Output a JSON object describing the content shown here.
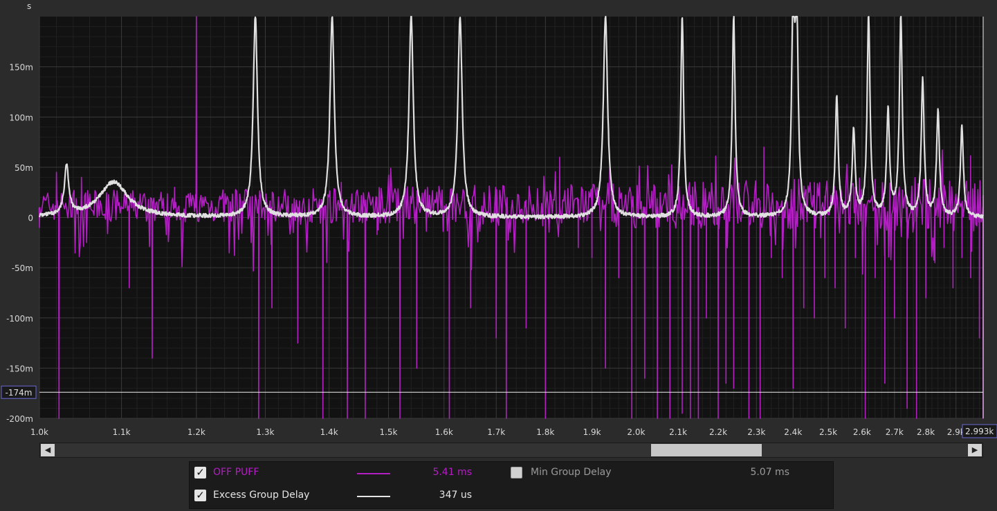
{
  "chart_data": {
    "type": "line",
    "x_unit": "Hz",
    "y_unit": "s",
    "xlim": [
      1000,
      2993
    ],
    "ylim": [
      -200,
      200
    ],
    "y_ticks": [
      {
        "value": 150,
        "label": "150m"
      },
      {
        "value": 100,
        "label": "100m"
      },
      {
        "value": 50,
        "label": "50m"
      },
      {
        "value": 0,
        "label": "0"
      },
      {
        "value": -50,
        "label": "-50m"
      },
      {
        "value": -100,
        "label": "-100m"
      },
      {
        "value": -150,
        "label": "-150m"
      },
      {
        "value": -200,
        "label": "-200m"
      }
    ],
    "x_ticks": [
      {
        "value": 1000,
        "label": "1.0k"
      },
      {
        "value": 1100,
        "label": "1.1k"
      },
      {
        "value": 1200,
        "label": "1.2k"
      },
      {
        "value": 1300,
        "label": "1.3k"
      },
      {
        "value": 1400,
        "label": "1.4k"
      },
      {
        "value": 1500,
        "label": "1.5k"
      },
      {
        "value": 1600,
        "label": "1.6k"
      },
      {
        "value": 1700,
        "label": "1.7k"
      },
      {
        "value": 1800,
        "label": "1.8k"
      },
      {
        "value": 1900,
        "label": "1.9k"
      },
      {
        "value": 2000,
        "label": "2.0k"
      },
      {
        "value": 2100,
        "label": "2.1k"
      },
      {
        "value": 2200,
        "label": "2.2k"
      },
      {
        "value": 2300,
        "label": "2.3k"
      },
      {
        "value": 2400,
        "label": "2.4k"
      },
      {
        "value": 2500,
        "label": "2.5k"
      },
      {
        "value": 2600,
        "label": "2.6k"
      },
      {
        "value": 2700,
        "label": "2.7k"
      },
      {
        "value": 2800,
        "label": "2.8k"
      },
      {
        "value": 2900,
        "label": "2.9k"
      }
    ],
    "x_scale": "log",
    "grid": true,
    "y_axis_unit_label": "s",
    "cursor": {
      "y": -174,
      "y_label": "-174m",
      "x": 2993,
      "x_label": "2.993k"
    },
    "series": [
      {
        "name": "OFF  PUFF",
        "color": "#b21fc2",
        "baseline": 10,
        "noise": 30,
        "x": [
          1000,
          1020,
          1023,
          1050,
          1110,
          1140,
          1170,
          1200,
          1220,
          1290,
          1310,
          1350,
          1390,
          1420,
          1430,
          1460,
          1480,
          1520,
          1550,
          1580,
          1610,
          1650,
          1700,
          1720,
          1760,
          1800,
          1830,
          1870,
          1900,
          1930,
          1960,
          1990,
          2020,
          2050,
          2080,
          2110,
          2130,
          2150,
          2170,
          2200,
          2220,
          2240,
          2280,
          2310,
          2320,
          2340,
          2370,
          2400,
          2430,
          2460,
          2490,
          2520,
          2550,
          2580,
          2610,
          2640,
          2670,
          2700,
          2740,
          2770,
          2800,
          2830,
          2860,
          2890,
          2920,
          2950,
          2980,
          2993
        ],
        "y": [
          -10,
          45,
          -200,
          40,
          -70,
          -140,
          30,
          200,
          10,
          -200,
          -90,
          -125,
          -200,
          35,
          -200,
          -200,
          20,
          -200,
          -150,
          5,
          -200,
          -90,
          -120,
          -200,
          -110,
          -200,
          60,
          -30,
          -40,
          -150,
          -60,
          -200,
          -160,
          -200,
          -200,
          -195,
          -200,
          -200,
          -100,
          -200,
          -165,
          -170,
          -200,
          -200,
          70,
          -40,
          -60,
          -170,
          -90,
          -100,
          -60,
          -70,
          -110,
          -40,
          -200,
          -60,
          -165,
          -100,
          -190,
          -200,
          -80,
          -45,
          -30,
          -70,
          -40,
          -60,
          -120,
          -200
        ]
      },
      {
        "name": "Excess Group Delay",
        "color": "#e0e0e0",
        "baseline": 0,
        "peaks": [
          {
            "x": 1032,
            "y": 50,
            "w": 0.003
          },
          {
            "x": 1090,
            "y": 35,
            "w": 0.02
          },
          {
            "x": 1285,
            "y": 200,
            "w": 0.003
          },
          {
            "x": 1405,
            "y": 200,
            "w": 0.003
          },
          {
            "x": 1540,
            "y": 200,
            "w": 0.003
          },
          {
            "x": 1630,
            "y": 200,
            "w": 0.003
          },
          {
            "x": 1930,
            "y": 200,
            "w": 0.003
          },
          {
            "x": 2110,
            "y": 200,
            "w": 0.002
          },
          {
            "x": 2240,
            "y": 200,
            "w": 0.002
          },
          {
            "x": 2400,
            "y": 200,
            "w": 0.002
          },
          {
            "x": 2410,
            "y": 200,
            "w": 0.002
          },
          {
            "x": 2525,
            "y": 120,
            "w": 0.002
          },
          {
            "x": 2575,
            "y": 85,
            "w": 0.002
          },
          {
            "x": 2620,
            "y": 200,
            "w": 0.002
          },
          {
            "x": 2680,
            "y": 105,
            "w": 0.002
          },
          {
            "x": 2720,
            "y": 200,
            "w": 0.002
          },
          {
            "x": 2790,
            "y": 135,
            "w": 0.002
          },
          {
            "x": 2840,
            "y": 105,
            "w": 0.002
          },
          {
            "x": 2920,
            "y": 90,
            "w": 0.002
          }
        ]
      }
    ]
  },
  "legend": {
    "items": [
      {
        "name": "OFF  PUFF",
        "value": "5.41 ms",
        "checked": true,
        "color": "#b21fc2"
      },
      {
        "name": "Excess Group Delay",
        "value": "347 us",
        "checked": true,
        "color": "#e6e6e6"
      },
      {
        "name": "Min Group Delay",
        "value": "5.07 ms",
        "checked": false,
        "color": "#9a9a9a"
      }
    ]
  },
  "scrollbar": {
    "left_arrow": "◀",
    "right_arrow": "▶",
    "position": 0.652,
    "extent": 0.114
  },
  "checkmark": "✓"
}
